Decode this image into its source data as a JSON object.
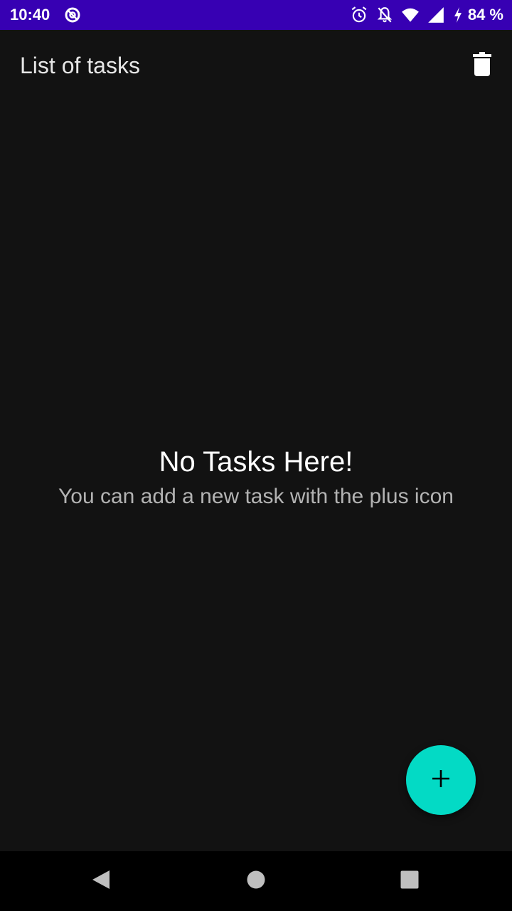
{
  "status_bar": {
    "time": "10:40",
    "battery": "84 %",
    "left_icon": "sync-alert-icon",
    "right_icons": [
      "alarm-icon",
      "notifications-off-icon",
      "wifi-icon",
      "cell-signal-icon",
      "charging-bolt-icon"
    ],
    "background_color": "#3700b3"
  },
  "app_bar": {
    "title": "List of tasks",
    "action_icon": "delete-icon"
  },
  "empty_state": {
    "title": "No Tasks Here!",
    "subtitle": "You can add a new task with the plus icon"
  },
  "fab": {
    "icon": "plus-icon",
    "color": "#03dac5"
  },
  "navigation_bar": {
    "buttons": [
      "back-icon",
      "home-icon",
      "recents-icon"
    ]
  },
  "theme": {
    "background": "#121212",
    "text_primary": "#ffffff",
    "text_secondary": "#b3b3b3"
  }
}
